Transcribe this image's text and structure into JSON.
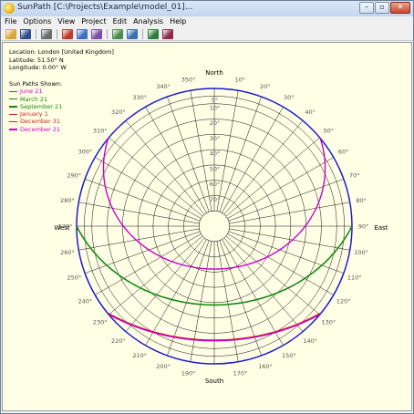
{
  "window": {
    "title": "SunPath [C:\\Projects\\Example\\model_01]...",
    "controls": {
      "minimize": "–",
      "maximize": "▫",
      "close": "✕"
    }
  },
  "menu": [
    "File",
    "Options",
    "View",
    "Project",
    "Edit",
    "Analysis",
    "Help"
  ],
  "toolbar": [
    {
      "icon": "open-folder-icon",
      "color": "#d9a63a"
    },
    {
      "icon": "save-icon",
      "color": "#2e4d8c"
    },
    {
      "sep": true
    },
    {
      "icon": "print-icon",
      "color": "#6b6b6b"
    },
    {
      "sep": true
    },
    {
      "icon": "color-bars-icon",
      "color": "#c0392b"
    },
    {
      "icon": "sun-path-icon",
      "color": "#3a6fc4"
    },
    {
      "icon": "chart-icon",
      "color": "#7a4ea0"
    },
    {
      "sep": true
    },
    {
      "icon": "grid-icon",
      "color": "#4c8c4a"
    },
    {
      "icon": "copy-icon",
      "color": "#3b6db3"
    },
    {
      "sep": true
    },
    {
      "icon": "book-icon",
      "color": "#2f7d3a"
    },
    {
      "icon": "help-book-icon",
      "color": "#8c2a4c"
    }
  ],
  "info": {
    "location": "Location: London [United Kingdom]",
    "latitude": "Latitude: 51.50° N",
    "longitude": "Longitude: 0.00° W"
  },
  "legend": {
    "title": "Sun Paths Shown:",
    "items": [
      {
        "label": "June 21",
        "color": "#cc00cc"
      },
      {
        "label": "March 21",
        "color": "#118811"
      },
      {
        "label": "September 21",
        "color": "#118811"
      },
      {
        "label": "January 1",
        "color": "#cc2222"
      },
      {
        "label": "December 31",
        "color": "#cc2222"
      },
      {
        "label": "December 21",
        "color": "#cc00cc"
      }
    ]
  },
  "compass": {
    "north": "North",
    "south": "South",
    "east": "East",
    "west": "West"
  },
  "colors": {
    "outer_circle": "#1a1acc",
    "grid": "#111111",
    "azimuth_labels": "#555555",
    "altitude_labels": "#555555"
  },
  "chart_data": {
    "type": "polar sun-path diagram",
    "azimuth_labels": [
      "350°",
      "10°",
      "20°",
      "30°",
      "40°",
      "50°",
      "60°",
      "70°",
      "80°",
      "90°",
      "100°",
      "110°",
      "120°",
      "130°",
      "140°",
      "150°",
      "160°",
      "170°",
      "190°",
      "200°",
      "210°",
      "220°",
      "230°",
      "240°",
      "250°",
      "260°",
      "270°",
      "280°",
      "290°",
      "300°",
      "310°",
      "320°",
      "330°",
      "340°"
    ],
    "altitude_labels": [
      "5°",
      "10°",
      "20°",
      "30°",
      "40°",
      "50°",
      "60°",
      "70°"
    ],
    "sun_paths": [
      {
        "name": "June 21",
        "color": "#cc00cc",
        "declination": 23.44
      },
      {
        "name": "March 21",
        "color": "#118811",
        "declination": 0
      },
      {
        "name": "September 21",
        "color": "#118811",
        "declination": 0
      },
      {
        "name": "January 1",
        "color": "#cc2222",
        "declination": -23.0
      },
      {
        "name": "December 31",
        "color": "#cc2222",
        "declination": -23.1
      },
      {
        "name": "December 21",
        "color": "#cc00cc",
        "declination": -23.44
      }
    ],
    "latitude": 51.5
  }
}
